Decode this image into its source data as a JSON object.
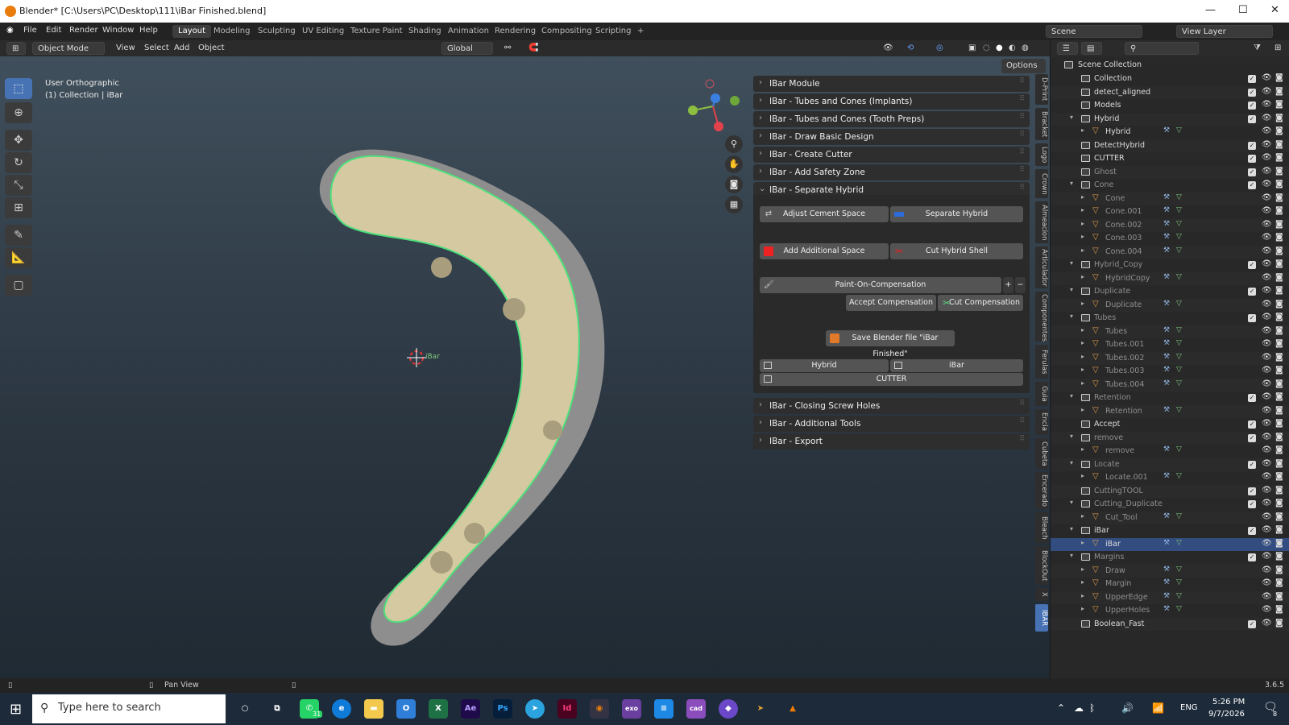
{
  "window": {
    "title": "Blender* [C:\\Users\\PC\\Desktop\\111\\iBar Finished.blend]"
  },
  "menu": [
    "File",
    "Edit",
    "Render",
    "Window",
    "Help"
  ],
  "workspaces": [
    "Layout",
    "Modeling",
    "Sculpting",
    "UV Editing",
    "Texture Paint",
    "Shading",
    "Animation",
    "Rendering",
    "Compositing",
    "Scripting"
  ],
  "scene": {
    "label": "Scene",
    "view_layer": "View Layer"
  },
  "header": {
    "mode": "Object Mode",
    "view": "View",
    "select": "Select",
    "add": "Add",
    "object": "Object",
    "transform": "Global",
    "options": "Options"
  },
  "viewport": {
    "view_name": "User Orthographic",
    "collection": "(1) Collection | iBar",
    "origin_label": "iBar"
  },
  "panels_top": [
    "IBar Module",
    "IBar - Tubes and Cones (Implants)",
    "IBar - Tubes and Cones (Tooth Preps)",
    "IBar - Draw Basic Design",
    "IBar - Create Cutter",
    "IBar - Add Safety Zone",
    "IBar - Separate Hybrid"
  ],
  "separate": {
    "adjust": "Adjust Cement Space",
    "separate": "Separate Hybrid",
    "add_space": "Add Additional Space",
    "cut_shell": "Cut Hybrid Shell",
    "paint": "Paint-On-Compensation",
    "accept": "Accept Compensation",
    "cut_comp": "Cut Compensation",
    "save": "Save Blender file \"iBar Finished\"",
    "hybrid": "Hybrid",
    "ibar": "iBar",
    "cutter": "CUTTER"
  },
  "panels_bottom": [
    "IBar - Closing Screw Holes",
    "IBar - Additional Tools",
    "IBar - Export"
  ],
  "vtabs": [
    "D-Print",
    "Bracket",
    "Logo",
    "Crown",
    "Almeacion",
    "Articulador",
    "Componentes",
    "Ferulas",
    "Guia",
    "Encia",
    "Cubeta",
    "Encerado",
    "Bleach",
    "BlockOut",
    "X",
    "IBAR"
  ],
  "outliner": {
    "root": "Scene Collection",
    "rows": [
      {
        "n": "Collection",
        "d": 1,
        "t": "c",
        "cb": 1
      },
      {
        "n": "detect_aligned",
        "d": 1,
        "t": "c",
        "cb": 1
      },
      {
        "n": "Models",
        "d": 1,
        "t": "c",
        "cb": 1
      },
      {
        "n": "Hybrid",
        "d": 1,
        "t": "c",
        "cb": 1,
        "e": "▾"
      },
      {
        "n": "Hybrid",
        "d": 2,
        "t": "m",
        "e": "▸"
      },
      {
        "n": "DetectHybrid",
        "d": 1,
        "t": "c",
        "cb": 1
      },
      {
        "n": "CUTTER",
        "d": 1,
        "t": "c",
        "cb": 1
      },
      {
        "n": "Ghost",
        "d": 1,
        "t": "c",
        "cb": 1,
        "dim": 1
      },
      {
        "n": "Cone",
        "d": 1,
        "t": "c",
        "cb": 1,
        "e": "▾",
        "dim": 1
      },
      {
        "n": "Cone",
        "d": 2,
        "t": "m",
        "e": "▸",
        "dim": 1
      },
      {
        "n": "Cone.001",
        "d": 2,
        "t": "m",
        "e": "▸",
        "dim": 1
      },
      {
        "n": "Cone.002",
        "d": 2,
        "t": "m",
        "e": "▸",
        "dim": 1
      },
      {
        "n": "Cone.003",
        "d": 2,
        "t": "m",
        "e": "▸",
        "dim": 1
      },
      {
        "n": "Cone.004",
        "d": 2,
        "t": "m",
        "e": "▸",
        "dim": 1
      },
      {
        "n": "Hybrid_Copy",
        "d": 1,
        "t": "c",
        "cb": 1,
        "e": "▾",
        "dim": 1
      },
      {
        "n": "HybridCopy",
        "d": 2,
        "t": "m",
        "e": "▸",
        "dim": 1
      },
      {
        "n": "Duplicate",
        "d": 1,
        "t": "c",
        "cb": 1,
        "e": "▾",
        "dim": 1
      },
      {
        "n": "Duplicate",
        "d": 2,
        "t": "m",
        "e": "▸",
        "dim": 1
      },
      {
        "n": "Tubes",
        "d": 1,
        "t": "c",
        "cb": 1,
        "e": "▾",
        "dim": 1
      },
      {
        "n": "Tubes",
        "d": 2,
        "t": "m",
        "e": "▸",
        "dim": 1
      },
      {
        "n": "Tubes.001",
        "d": 2,
        "t": "m",
        "e": "▸",
        "dim": 1
      },
      {
        "n": "Tubes.002",
        "d": 2,
        "t": "m",
        "e": "▸",
        "dim": 1
      },
      {
        "n": "Tubes.003",
        "d": 2,
        "t": "m",
        "e": "▸",
        "dim": 1
      },
      {
        "n": "Tubes.004",
        "d": 2,
        "t": "m",
        "e": "▸",
        "dim": 1
      },
      {
        "n": "Retention",
        "d": 1,
        "t": "c",
        "cb": 1,
        "e": "▾",
        "dim": 1
      },
      {
        "n": "Retention",
        "d": 2,
        "t": "m",
        "e": "▸",
        "dim": 1
      },
      {
        "n": "Accept",
        "d": 1,
        "t": "c",
        "cb": 1
      },
      {
        "n": "remove",
        "d": 1,
        "t": "c",
        "cb": 1,
        "e": "▾",
        "dim": 1
      },
      {
        "n": "remove",
        "d": 2,
        "t": "m",
        "e": "▸",
        "dim": 1
      },
      {
        "n": "Locate",
        "d": 1,
        "t": "c",
        "cb": 1,
        "e": "▾",
        "dim": 1
      },
      {
        "n": "Locate.001",
        "d": 2,
        "t": "m",
        "e": "▸",
        "dim": 1
      },
      {
        "n": "CuttingTOOL",
        "d": 1,
        "t": "c",
        "cb": 1,
        "dim": 1
      },
      {
        "n": "Cutting_Duplicate",
        "d": 1,
        "t": "c",
        "cb": 1,
        "e": "▾",
        "dim": 1
      },
      {
        "n": "Cut_Tool",
        "d": 2,
        "t": "m",
        "e": "▸",
        "dim": 1
      },
      {
        "n": "iBar",
        "d": 1,
        "t": "c",
        "cb": 1,
        "e": "▾"
      },
      {
        "n": "iBar",
        "d": 2,
        "t": "m",
        "e": "▸",
        "sel": 1
      },
      {
        "n": "Margins",
        "d": 1,
        "t": "c",
        "cb": 1,
        "e": "▾",
        "dim": 1
      },
      {
        "n": "Draw",
        "d": 2,
        "t": "m",
        "e": "▸",
        "dim": 1
      },
      {
        "n": "Margin",
        "d": 2,
        "t": "m",
        "e": "▸",
        "dim": 1
      },
      {
        "n": "UpperEdge",
        "d": 2,
        "t": "m",
        "e": "▸",
        "dim": 1
      },
      {
        "n": "UpperHoles",
        "d": 2,
        "t": "m",
        "e": "▸",
        "dim": 1
      },
      {
        "n": "Boolean_Fast",
        "d": 1,
        "t": "c",
        "cb": 1
      }
    ]
  },
  "status": {
    "action": "Pan View",
    "version": "3.6.5"
  },
  "taskbar": {
    "search": "Type here to search",
    "time": "5:26 PM",
    "date": "9/7/2026",
    "lang": "ENG",
    "badge": "31",
    "notif": "8"
  }
}
